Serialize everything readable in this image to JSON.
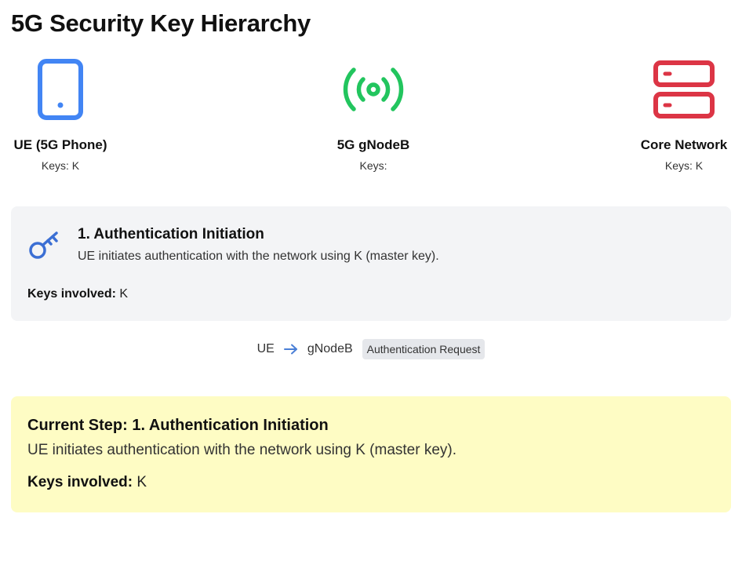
{
  "page": {
    "title": "5G Security Key Hierarchy"
  },
  "colors": {
    "ue": "#4285f4",
    "gnodeb": "#22c55e",
    "core": "#dc3545",
    "step_card_bg": "#f3f4f6",
    "current_bg": "#fefcc4",
    "arrow": "#4a7fd6"
  },
  "entities": [
    {
      "name": "UE (5G Phone)",
      "keys_label": "Keys:",
      "keys": "K",
      "icon": "smartphone-icon"
    },
    {
      "name": "5G gNodeB",
      "keys_label": "Keys:",
      "keys": "",
      "icon": "radio-tower-icon"
    },
    {
      "name": "Core Network",
      "keys_label": "Keys:",
      "keys": "K",
      "icon": "server-icon"
    }
  ],
  "step": {
    "icon": "key-icon",
    "title": "1. Authentication Initiation",
    "description": "UE initiates authentication with the network using K (master key).",
    "keys_label": "Keys involved:",
    "keys": "K"
  },
  "flow": {
    "from": "UE",
    "arrow_icon": "arrow-right-icon",
    "to": "gNodeB",
    "message": "Authentication Request"
  },
  "current": {
    "label": "Current Step:",
    "title": "1. Authentication Initiation",
    "description": "UE initiates authentication with the network using K (master key).",
    "keys_label": "Keys involved:",
    "keys": "K"
  }
}
